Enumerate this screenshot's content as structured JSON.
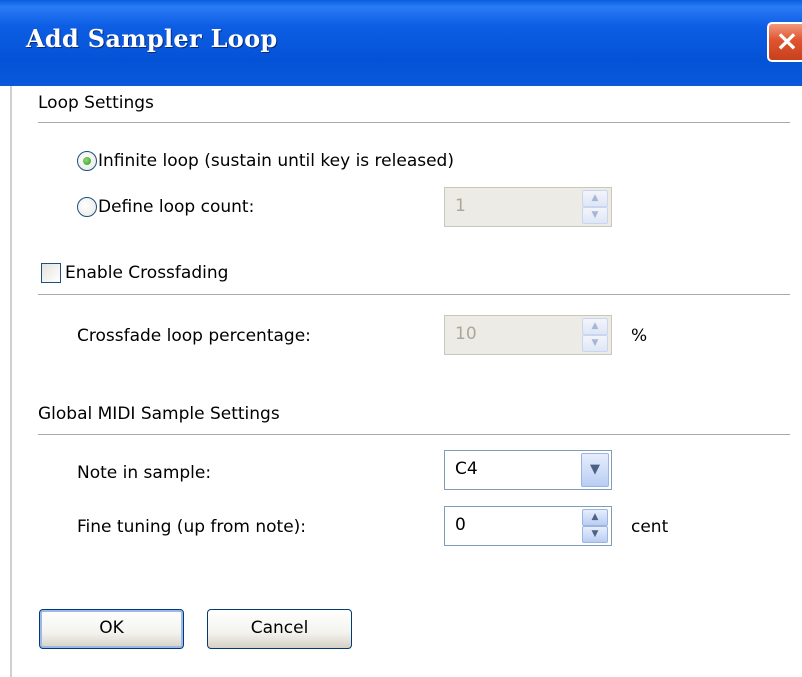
{
  "window": {
    "title": "Add Sampler Loop",
    "close_icon": "×"
  },
  "loop_settings": {
    "heading": "Loop Settings",
    "infinite_label": "Infinite loop (sustain until key is released)",
    "infinite_selected": true,
    "define_label": "Define loop count:",
    "define_selected": false,
    "loop_count_value": "1"
  },
  "crossfade": {
    "enable_label": "Enable Crossfading",
    "enabled": false,
    "percentage_label": "Crossfade loop percentage:",
    "percentage_value": "10",
    "percentage_unit": "%"
  },
  "midi": {
    "heading": "Global MIDI Sample Settings",
    "note_label": "Note in sample:",
    "note_value": "C4",
    "tuning_label": "Fine tuning (up from note):",
    "tuning_value": "0",
    "tuning_unit": "cent"
  },
  "buttons": {
    "ok": "OK",
    "cancel": "Cancel"
  },
  "icons": {
    "spin_up": "▲",
    "spin_down": "▼",
    "dropdown": "▼"
  },
  "colors": {
    "titlebar": "#0452d6",
    "close": "#e0532f",
    "radio_dot": "#2aa11c"
  }
}
